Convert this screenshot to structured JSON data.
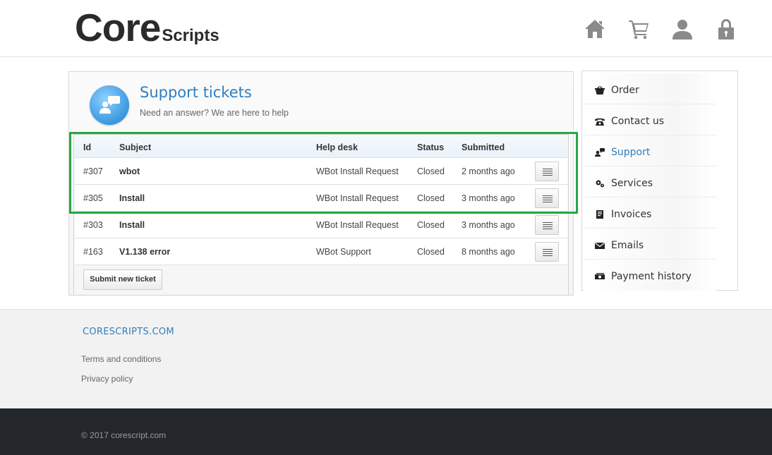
{
  "header": {
    "logo_main": "Core",
    "logo_sub": "Scripts",
    "icons": [
      "home-icon",
      "cart-icon",
      "user-icon",
      "lock-icon"
    ]
  },
  "panel": {
    "title": "Support tickets",
    "subtitle": "Need an answer? We are here to help",
    "icon": "chat-user-icon"
  },
  "table": {
    "columns": [
      "Id",
      "Subject",
      "Help desk",
      "Status",
      "Submitted"
    ],
    "rows": [
      {
        "id": "#307",
        "subject": "wbot",
        "desk": "WBot Install Request",
        "status": "Closed",
        "submitted": "2 months ago"
      },
      {
        "id": "#305",
        "subject": "Install",
        "desk": "WBot Install Request",
        "status": "Closed",
        "submitted": "3 months ago"
      },
      {
        "id": "#303",
        "subject": "Install",
        "desk": "WBot Install Request",
        "status": "Closed",
        "submitted": "3 months ago"
      },
      {
        "id": "#163",
        "subject": "V1.138 error",
        "desk": "WBot Support",
        "status": "Closed",
        "submitted": "8 months ago"
      }
    ]
  },
  "submit_label": "Submit new ticket",
  "sidebar": {
    "items": [
      {
        "label": "Order",
        "icon": "basket-icon"
      },
      {
        "label": "Contact us",
        "icon": "phone-icon"
      },
      {
        "label": "Support",
        "icon": "support-icon",
        "active": true
      },
      {
        "label": "Services",
        "icon": "gears-icon"
      },
      {
        "label": "Invoices",
        "icon": "invoice-icon"
      },
      {
        "label": "Emails",
        "icon": "envelope-icon"
      },
      {
        "label": "Payment history",
        "icon": "money-icon"
      }
    ]
  },
  "footer": {
    "brand": "CORESCRIPTS.COM",
    "links": [
      "Terms and conditions",
      "Privacy policy"
    ],
    "copyright": "© 2017 corescript.com"
  },
  "colors": {
    "accent": "#2f7ec1",
    "highlight": "#27a744",
    "bottom_bar": "#23272b"
  }
}
